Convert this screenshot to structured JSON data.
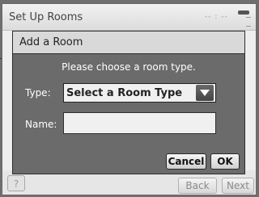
{
  "background_window": {
    "title": "Set Up Rooms",
    "status_dashes": "-- : --",
    "help_label": "?",
    "back_label": "Back",
    "next_label": "Next"
  },
  "dialog": {
    "title": "Add a Room",
    "instruction": "Please choose a room type.",
    "type_label": "Type:",
    "type_select_value": "Select a Room Type",
    "name_label": "Name:",
    "name_value": "",
    "cancel_label": "Cancel",
    "ok_label": "OK"
  },
  "icons": {
    "select_arrow": "triangle-down-icon",
    "toggle": "toggle-icon",
    "menu": "menu-lines-icon"
  },
  "colors": {
    "dialog_body": "#6b6b6b",
    "dialog_header": "#d9d9d9",
    "backdrop": "#6f6f6f"
  }
}
